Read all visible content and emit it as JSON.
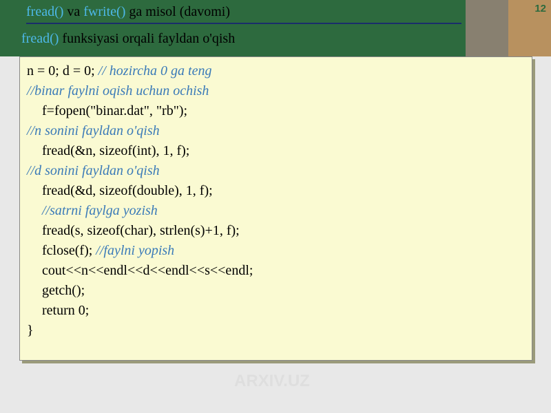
{
  "page_number": "12",
  "header": {
    "title_fn1": "fread()",
    "title_mid": " va ",
    "title_fn2": "fwrite()",
    "title_rest": " ga misol (davomi)",
    "subtitle_fn": "fread()",
    "subtitle_rest": " funksiyasi orqali fayldan o'qish"
  },
  "code": {
    "l1a": "n = 0; d = 0; ",
    "l1b": "// hozircha 0 ga teng",
    "l2": "//binar faylni oqish uchun ochish",
    "l3": "f=fopen(\"binar.dat\", \"rb\");",
    "l4": "//n sonini fayldan o'qish",
    "l5": "fread(&n, sizeof(int), 1, f);",
    "l6": "//d sonini fayldan o'qish",
    "l7": "fread(&d, sizeof(double), 1, f);",
    "l8": "//satrni faylga yozish",
    "l9": "fread(s, sizeof(char), strlen(s)+1, f);",
    "l10a": "fclose(f); ",
    "l10b": "//faylni yopish",
    "l11": "cout<<n<<endl<<d<<endl<<s<<endl;",
    "l12": "getch();",
    "l13": "return 0;",
    "l14": "}"
  },
  "watermark": "ARXIV.UZ"
}
